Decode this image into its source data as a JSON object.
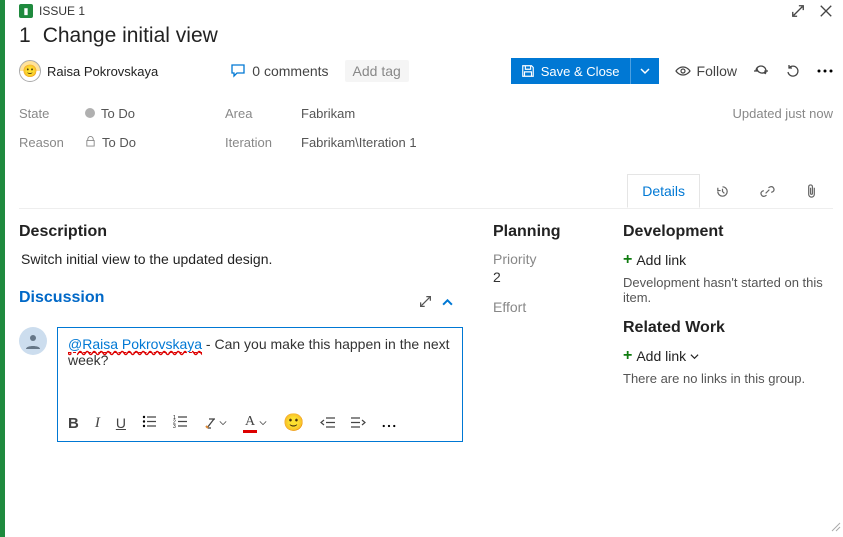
{
  "header": {
    "issue_label": "ISSUE 1",
    "title_num": "1",
    "title": "Change initial view",
    "user": "Raisa Pokrovskaya",
    "comments": "0 comments",
    "add_tag": "Add tag",
    "save_label": "Save & Close",
    "follow_label": "Follow"
  },
  "fields": {
    "state_label": "State",
    "state_value": "To Do",
    "area_label": "Area",
    "area_value": "Fabrikam",
    "updated": "Updated just now",
    "reason_label": "Reason",
    "reason_value": "To Do",
    "iteration_label": "Iteration",
    "iteration_value": "Fabrikam\\Iteration 1"
  },
  "tabs": {
    "details": "Details"
  },
  "description": {
    "heading": "Description",
    "body": "Switch initial view to the updated design."
  },
  "discussion": {
    "heading": "Discussion",
    "mention": "@Raisa Pokrovskaya",
    "text": " - Can you make this happen in the next week?"
  },
  "planning": {
    "heading": "Planning",
    "priority_label": "Priority",
    "priority_value": "2",
    "effort_label": "Effort"
  },
  "development": {
    "heading": "Development",
    "add_link": "Add link",
    "empty": "Development hasn't started on this item."
  },
  "related": {
    "heading": "Related Work",
    "add_link": "Add link",
    "empty": "There are no links in this group."
  }
}
